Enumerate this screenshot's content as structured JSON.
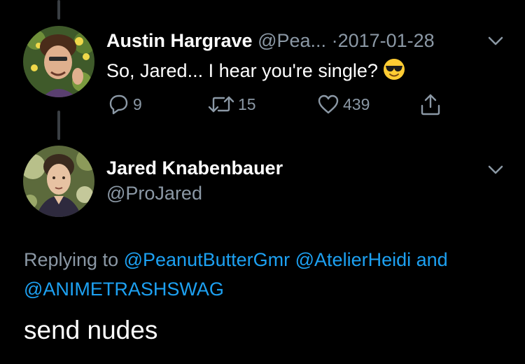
{
  "colors": {
    "background": "#000000",
    "primary_text": "#ffffff",
    "secondary_text": "#8b98a5",
    "link": "#1da1f2",
    "thread_line": "#3a3f44"
  },
  "tweet1": {
    "display_name": "Austin Hargrave",
    "handle": "@Pea...",
    "separator": "·",
    "date": "2017-01-28",
    "text": "So, Jared... I hear you're single?",
    "emoji": "smiling-face-with-sunglasses",
    "actions": {
      "reply_count": "9",
      "retweet_count": "15",
      "like_count": "439"
    }
  },
  "tweet2": {
    "display_name": "Jared Knabenbauer",
    "handle": "@ProJared",
    "replying_prefix": "Replying to",
    "mentions": [
      "@PeanutButterGmr",
      "@AtelierHeidi",
      "@ANIMETRASHSWAG"
    ],
    "conjunction": "and",
    "text": "send nudes"
  }
}
